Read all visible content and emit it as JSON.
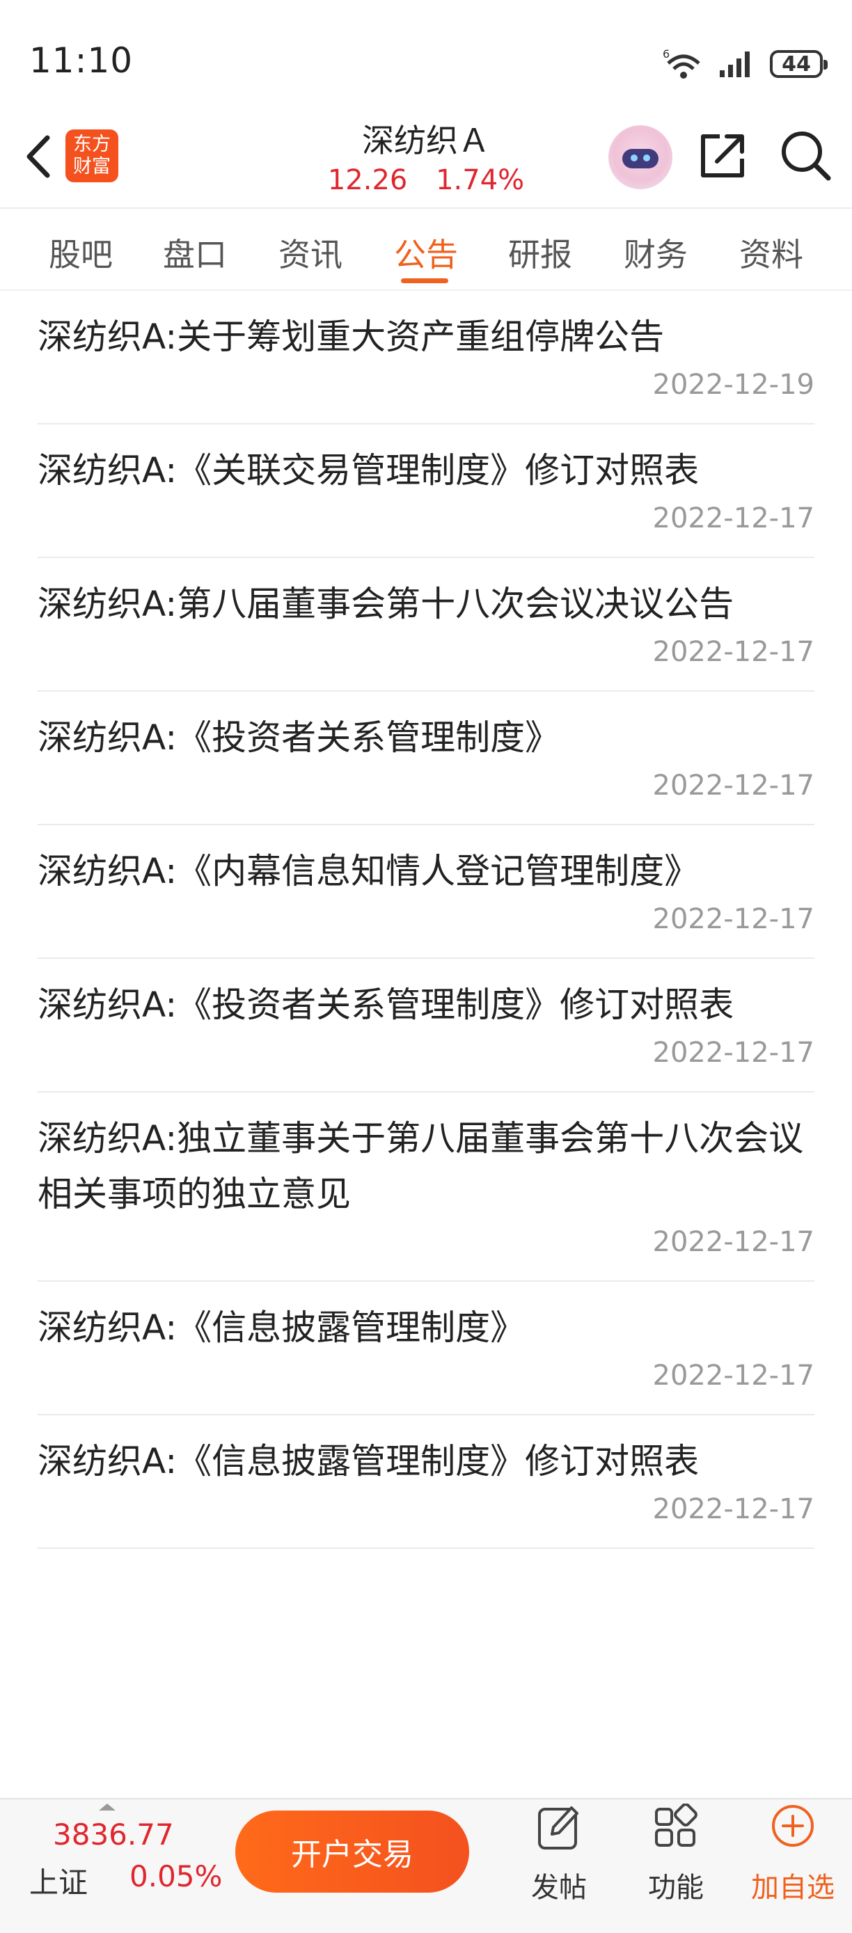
{
  "status_bar": {
    "time": "11:10",
    "battery": "44",
    "network": "6"
  },
  "header": {
    "logo_line1": "东方",
    "logo_line2": "财富",
    "stock_name": "深纺织Ａ",
    "price": "12.26",
    "change_pct": "1.74%"
  },
  "tabs": [
    {
      "label": "股吧"
    },
    {
      "label": "盘口"
    },
    {
      "label": "资讯"
    },
    {
      "label": "公告",
      "active": true
    },
    {
      "label": "研报"
    },
    {
      "label": "财务"
    },
    {
      "label": "资料"
    }
  ],
  "announcements": [
    {
      "title": "深纺织A:关于筹划重大资产重组停牌公告",
      "date": "2022-12-19"
    },
    {
      "title": "深纺织A:《关联交易管理制度》修订对照表",
      "date": "2022-12-17"
    },
    {
      "title": "深纺织A:第八届董事会第十八次会议决议公告",
      "date": "2022-12-17"
    },
    {
      "title": "深纺织A:《投资者关系管理制度》",
      "date": "2022-12-17"
    },
    {
      "title": "深纺织A:《内幕信息知情人登记管理制度》",
      "date": "2022-12-17"
    },
    {
      "title": "深纺织A:《投资者关系管理制度》修订对照表",
      "date": "2022-12-17"
    },
    {
      "title": "深纺织A:独立董事关于第八届董事会第十八次会议相关事项的独立意见",
      "date": "2022-12-17"
    },
    {
      "title": "深纺织A:《信息披露管理制度》",
      "date": "2022-12-17"
    },
    {
      "title": "深纺织A:《信息披露管理制度》修订对照表",
      "date": "2022-12-17"
    }
  ],
  "bottom_bar": {
    "index_value": "3836.77",
    "index_name": "上证",
    "index_change": "0.05%",
    "open_account": "开户交易",
    "post": "发帖",
    "functions": "功能",
    "add_favorite": "加自选"
  },
  "colors": {
    "accent": "#f0611e",
    "up": "#e0262e"
  }
}
